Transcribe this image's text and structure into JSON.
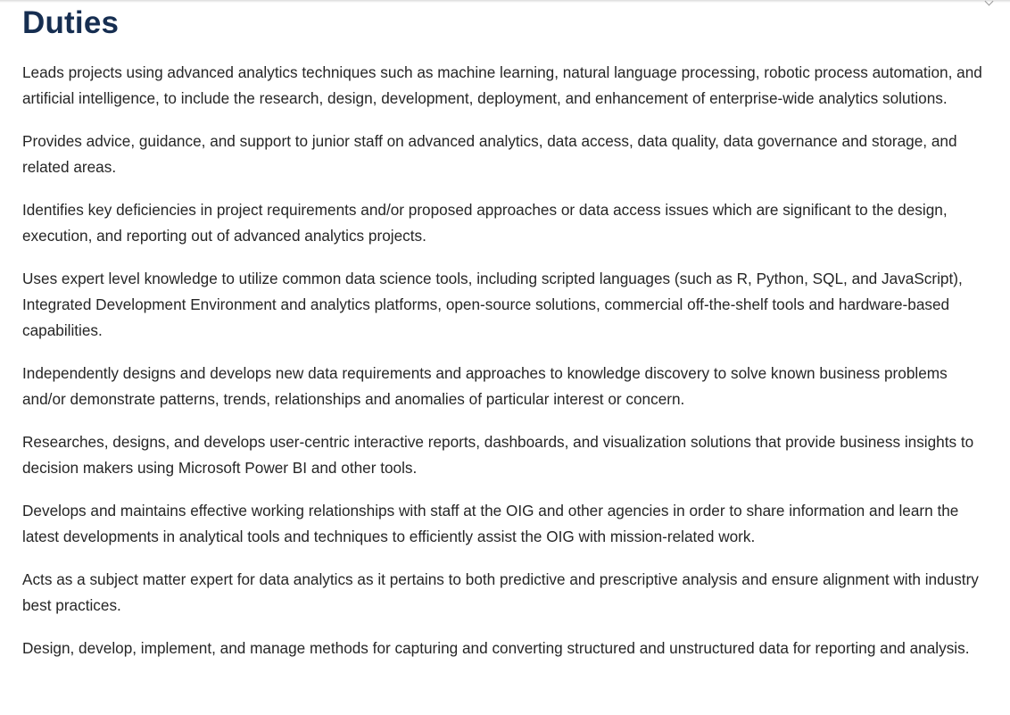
{
  "section": {
    "title": "Duties"
  },
  "duties": [
    "Leads projects using advanced analytics techniques such as machine learning, natural language processing, robotic process automation, and artificial intelligence, to include the research, design, development, deployment, and enhancement of enterprise-wide analytics solutions.",
    "Provides advice, guidance, and support to junior staff on advanced analytics, data access, data quality, data governance and storage, and related areas.",
    "Identifies key deficiencies in project requirements and/or proposed approaches or data access issues which are significant to the design, execution, and reporting out of advanced analytics projects.",
    "Uses expert level knowledge to utilize common data science tools, including scripted languages (such as R, Python, SQL, and JavaScript), Integrated Development Environment and analytics platforms, open-source solutions, commercial off-the-shelf tools and hardware-based capabilities.",
    "Independently designs and develops new data requirements and approaches to knowledge discovery to solve known business problems and/or demonstrate patterns, trends, relationships and anomalies of particular interest or concern.",
    "Researches, designs, and develops user-centric interactive reports, dashboards, and visualization solutions that provide business insights to decision makers using Microsoft Power BI and other tools.",
    "Develops and maintains effective working relationships with staff at the OIG and other agencies in order to share information and learn the latest developments in analytical tools and techniques to efficiently assist the OIG with mission-related work.",
    "Acts as a subject matter expert for data analytics as it pertains to both predictive and prescriptive analysis and ensure alignment with industry best practices.",
    "Design, develop, implement, and manage methods for capturing and converting structured and unstructured data for reporting and analysis."
  ],
  "colors": {
    "heading": "#162e51",
    "body_text": "#262626",
    "background": "#ffffff"
  },
  "icons": {
    "scroll_indicator": "chevron-down-icon"
  }
}
